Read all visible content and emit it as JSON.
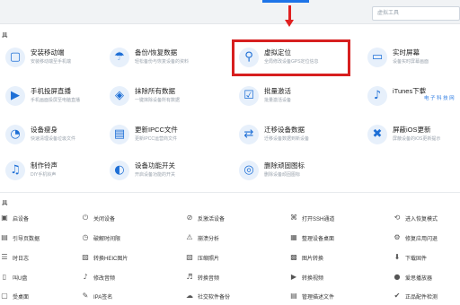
{
  "search": {
    "placeholder": "虚拟工具"
  },
  "sections": {
    "tools_label": "具",
    "common_label": "具"
  },
  "tools": [
    {
      "title": "安装移动端",
      "desc": "安装移动端至手机端",
      "icon": "▢",
      "icon_name": "mobile-install-icon"
    },
    {
      "title": "备份/恢复数据",
      "desc": "轻松备份与恢复设备的资料",
      "icon": "☂",
      "icon_name": "umbrella-backup-icon"
    },
    {
      "title": "虚拟定位",
      "desc": "全局修改设备GPS定位信息",
      "icon": "⚲",
      "icon_name": "location-pin-icon"
    },
    {
      "title": "实时屏幕",
      "desc": "设备实时屏幕画面",
      "icon": "▭",
      "icon_name": "realtime-screen-icon"
    },
    {
      "title": "手机投屏直播",
      "desc": "手机画面投屏至电脑直播",
      "icon": "▶",
      "icon_name": "cast-icon"
    },
    {
      "title": "抹除所有数据",
      "desc": "一键抹除设备所有数据",
      "icon": "◈",
      "icon_name": "erase-icon"
    },
    {
      "title": "批量激活",
      "desc": "批量激活设备",
      "icon": "☑",
      "icon_name": "batch-activate-icon"
    },
    {
      "title": "iTunes下载",
      "desc": "",
      "icon": "♪",
      "icon_name": "itunes-icon"
    },
    {
      "title": "设备瘦身",
      "desc": "快速清理设备垃圾文件",
      "icon": "◔",
      "icon_name": "slim-icon"
    },
    {
      "title": "更新IPCC文件",
      "desc": "更新IPCC运营商文件",
      "icon": "▤",
      "icon_name": "ipcc-file-icon"
    },
    {
      "title": "迁移设备数据",
      "desc": "迁移设备数据到新设备",
      "icon": "⇄",
      "icon_name": "migrate-icon"
    },
    {
      "title": "屏蔽iOS更新",
      "desc": "屏蔽设备的iOS更新提示",
      "icon": "✖",
      "icon_name": "block-update-icon"
    },
    {
      "title": "制作铃声",
      "desc": "DIY手机铃声",
      "icon": "♫",
      "icon_name": "ringtone-icon"
    },
    {
      "title": "设备功能开关",
      "desc": "开启设备功能的开关",
      "icon": "◐",
      "icon_name": "function-switch-icon"
    },
    {
      "title": "删除顽固图标",
      "desc": "删除设备顽固图标",
      "icon": "◎",
      "icon_name": "delete-icon-icon"
    }
  ],
  "watermark": "电 子 科 技 网",
  "common_tools": [
    {
      "label": "启设备",
      "icon": "▣",
      "icon_name": "restart-device-icon"
    },
    {
      "label": "关闭设备",
      "icon": "⏻",
      "icon_name": "power-off-icon"
    },
    {
      "label": "反激活设备",
      "icon": "⊘",
      "icon_name": "deactivate-icon"
    },
    {
      "label": "打开SSH通道",
      "icon": "⌘",
      "icon_name": "ssh-icon"
    },
    {
      "label": "进入恢复模式",
      "icon": "⟲",
      "icon_name": "recovery-mode-icon"
    },
    {
      "label": "引导页数据",
      "icon": "▤",
      "icon_name": "guide-data-icon"
    },
    {
      "label": "破解时间限",
      "icon": "◷",
      "icon_name": "time-limit-icon"
    },
    {
      "label": "崩溃分析",
      "icon": "⚠",
      "icon_name": "crash-analysis-icon"
    },
    {
      "label": "整理设备桌面",
      "icon": "▦",
      "icon_name": "desktop-arrange-icon"
    },
    {
      "label": "修复应用闪退",
      "icon": "⚙",
      "icon_name": "fix-crash-icon"
    },
    {
      "label": "时日志",
      "icon": "☰",
      "icon_name": "log-icon"
    },
    {
      "label": "转换HEIC图片",
      "icon": "▨",
      "icon_name": "heic-convert-icon"
    },
    {
      "label": "压缩照片",
      "icon": "▧",
      "icon_name": "compress-photo-icon"
    },
    {
      "label": "图片转换",
      "icon": "▩",
      "icon_name": "image-convert-icon"
    },
    {
      "label": "下载固件",
      "icon": "⬇",
      "icon_name": "download-firmware-icon"
    },
    {
      "label": "叫U盘",
      "icon": "▯",
      "icon_name": "usb-icon"
    },
    {
      "label": "修改音频",
      "icon": "♪",
      "icon_name": "audio-edit-icon"
    },
    {
      "label": "转换音频",
      "icon": "♬",
      "icon_name": "audio-convert-icon"
    },
    {
      "label": "转换视频",
      "icon": "▶",
      "icon_name": "video-convert-icon"
    },
    {
      "label": "爱思播放器",
      "icon": "●",
      "icon_name": "player-icon"
    },
    {
      "label": "受桌面",
      "icon": "▢",
      "icon_name": "desktop-icon"
    },
    {
      "label": "IPA签名",
      "icon": "✎",
      "icon_name": "ipa-sign-icon"
    },
    {
      "label": "社交软件备份",
      "icon": "☁",
      "icon_name": "social-backup-icon"
    },
    {
      "label": "管理描述文件",
      "icon": "▤",
      "icon_name": "profile-manage-icon"
    },
    {
      "label": "正品配件检测",
      "icon": "✔",
      "icon_name": "accessory-check-icon"
    }
  ]
}
